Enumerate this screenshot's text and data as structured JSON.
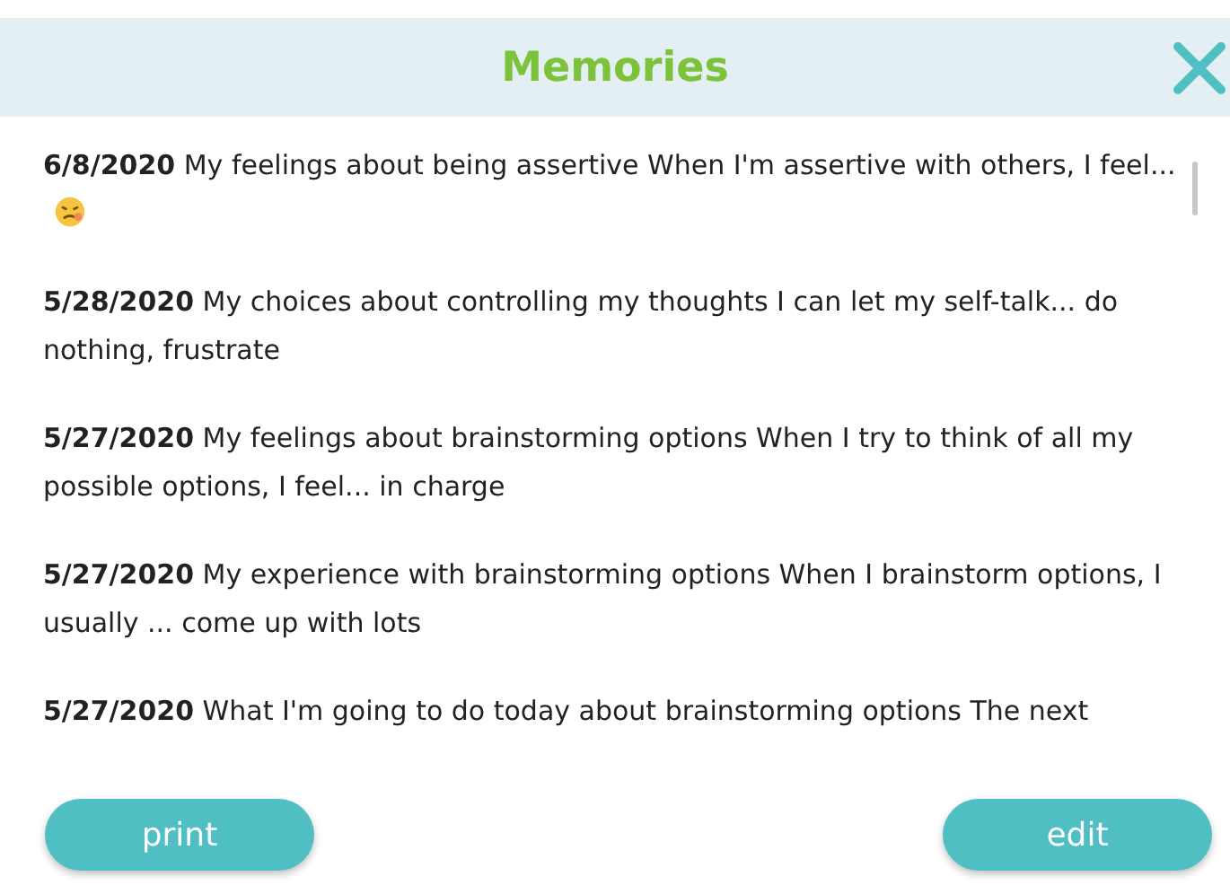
{
  "header": {
    "title": "Memories"
  },
  "entries": [
    {
      "text": "**6/8/2020** My feelings about being assertive When I'm assertive with others, I feel...",
      "emoji": true
    },
    {
      "text": "**5/28/2020** My choices about controlling my thoughts I can let my self-talk... do nothing, frustrate",
      "emoji": false
    },
    {
      "text": "**5/27/2020** My feelings about brainstorming options When I try to think of all my possible options, I feel... in charge",
      "emoji": false
    },
    {
      "text": "**5/27/2020** My experience with brainstorming options When I brainstorm options, I usually ... come up with lots",
      "emoji": false
    },
    {
      "text": "**5/27/2020** What I'm going to do today about brainstorming options The next",
      "emoji": false
    }
  ],
  "buttons": [
    "print",
    "edit"
  ]
}
